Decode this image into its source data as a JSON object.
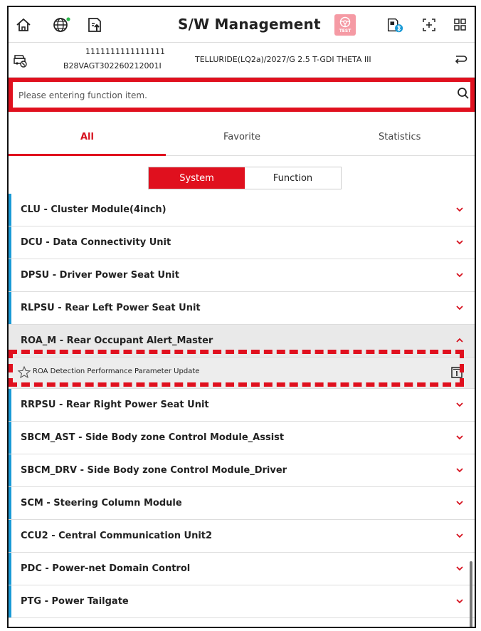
{
  "header": {
    "title": "S/W Management",
    "test_label": "TEST",
    "icons": [
      "home-icon",
      "globe-icon",
      "upload-icon",
      "test-badge-icon",
      "vci-bluetooth-icon",
      "screen-capture-icon",
      "grid-menu-icon"
    ]
  },
  "vehicle": {
    "vin_top": "1111111111111111",
    "vin_bottom": "B28VAGT302260212001I",
    "model": "TELLURIDE(LQ2a)/2027/G 2.5 T-GDI THETA III"
  },
  "search": {
    "placeholder": "Please entering function item."
  },
  "tabs": [
    "All",
    "Favorite",
    "Statistics"
  ],
  "segment": {
    "system": "System",
    "function": "Function"
  },
  "systems": [
    "CLU - Cluster Module(4inch)",
    "DCU - Data Connectivity Unit",
    "DPSU - Driver Power Seat Unit",
    "RLPSU - Rear Left Power Seat Unit",
    "ROA_M - Rear Occupant Alert_Master",
    "RRPSU - Rear Right Power Seat Unit",
    "SBCM_AST - Side Body zone Control Module_Assist",
    "SBCM_DRV - Side Body zone Control Module_Driver",
    "SCM - Steering Column Module",
    "CCU2 - Central Communication Unit2",
    "PDC - Power-net Domain Control",
    "PTG - Power Tailgate"
  ],
  "expanded_function": "ROA Detection Performance Parameter Update",
  "colors": {
    "accent": "#e0101e",
    "rowbar": "#1a9ad6"
  }
}
